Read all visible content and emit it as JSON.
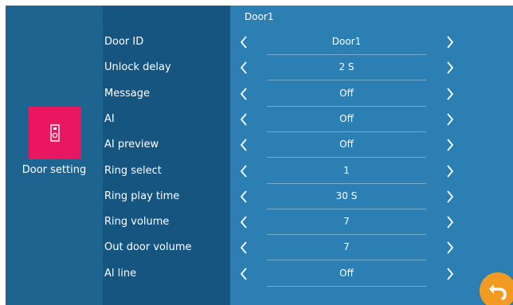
{
  "header": {
    "title": "Door1"
  },
  "sidebar": {
    "label": "Door setting",
    "icon": "door-station-icon"
  },
  "rows": [
    {
      "label": "Door ID",
      "value": "Door1"
    },
    {
      "label": "Unlock delay",
      "value": "2 S"
    },
    {
      "label": "Message",
      "value": "Off"
    },
    {
      "label": "AI",
      "value": "Off"
    },
    {
      "label": "AI preview",
      "value": "Off"
    },
    {
      "label": "Ring select",
      "value": "1"
    },
    {
      "label": "Ring play time",
      "value": "30 S"
    },
    {
      "label": "Ring volume",
      "value": "7"
    },
    {
      "label": "Out door volume",
      "value": "7"
    },
    {
      "label": "Al line",
      "value": "Off"
    }
  ],
  "back_button": {
    "icon": "back-arrow-icon"
  },
  "colors": {
    "accent_tile": "#e8175f",
    "back_button": "#f39a22",
    "panel": "#2b7fb2",
    "label_column": "#15557f",
    "sidebar": "#1d6590"
  }
}
